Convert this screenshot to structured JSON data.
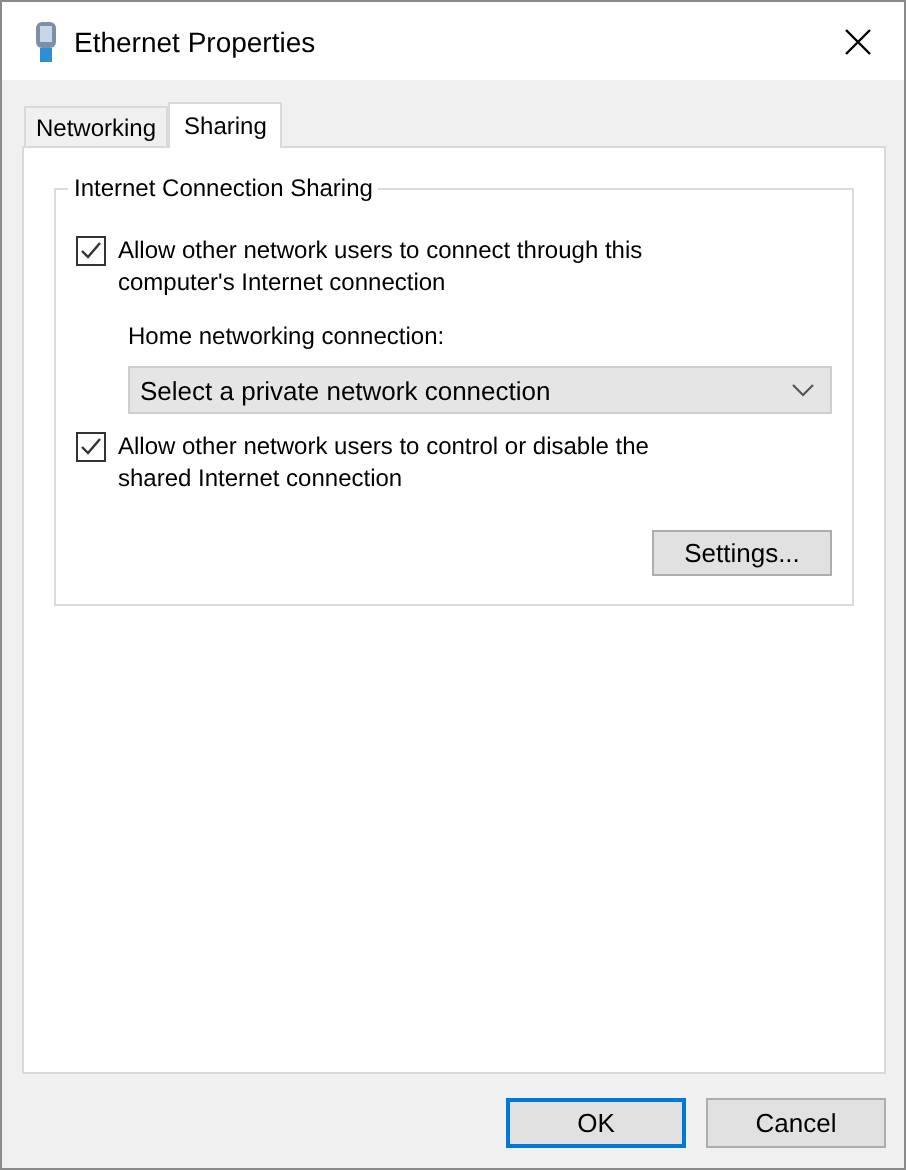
{
  "window": {
    "title": "Ethernet Properties"
  },
  "tabs": [
    {
      "label": "Networking",
      "selected": false
    },
    {
      "label": "Sharing",
      "selected": true
    }
  ],
  "group": {
    "title": "Internet Connection Sharing",
    "options": [
      {
        "label": "Allow other network users to connect through this computer's Internet connection",
        "checked": true
      },
      {
        "label": "Allow other network users to control or disable the shared Internet connection",
        "checked": true
      }
    ],
    "dropdown": {
      "label": "Home networking connection:",
      "value": "Select a private network connection"
    },
    "settings_button": "Settings..."
  },
  "buttons": [
    {
      "label": "OK",
      "default": true
    },
    {
      "label": "Cancel",
      "default": false
    }
  ]
}
